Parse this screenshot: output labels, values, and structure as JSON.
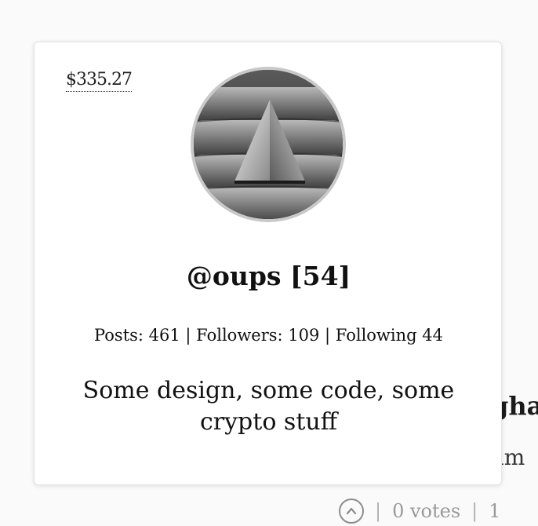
{
  "profile": {
    "payout": "$335.27",
    "username": "@oups [54]",
    "stats": "Posts: 461 | Followers: 109 | Following 44",
    "bio": "Some design, some code, some crypto stuff",
    "avatar_icon": "triangle-on-hand-icon"
  },
  "background_post": {
    "heading_fragment": "gha",
    "excerpt_fragment": "am",
    "upvote_icon": "chevron-up-circle-icon",
    "separator": "|",
    "votes_label": "0 votes",
    "trailing_fragment": "1"
  },
  "colors": {
    "card_background": "#ffffff",
    "page_background": "#fafafa",
    "text": "#111111",
    "muted": "#9a9a9a"
  }
}
